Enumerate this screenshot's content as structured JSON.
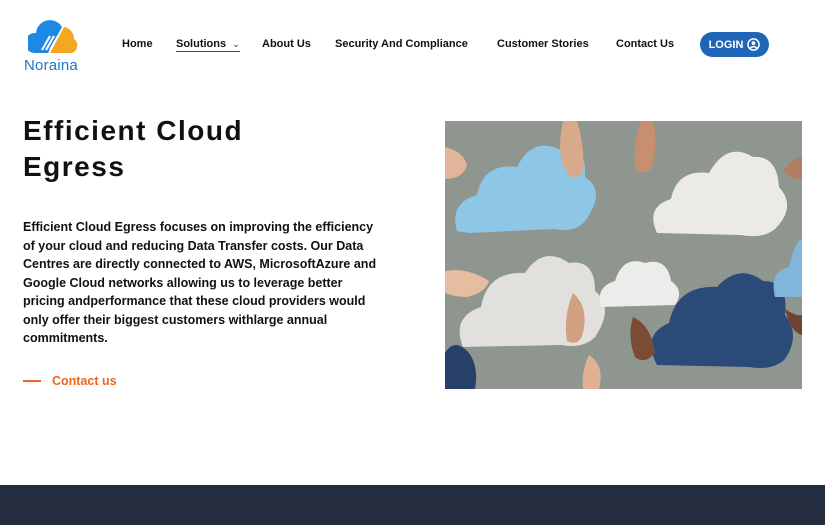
{
  "brand": {
    "name": "Noraina",
    "logo_colors": [
      "#1e88e5",
      "#f5a623"
    ]
  },
  "nav": {
    "items": [
      {
        "label": "Home"
      },
      {
        "label": "Solutions",
        "dropdown": true,
        "active": true
      },
      {
        "label": "About Us"
      },
      {
        "label": "Security And Compliance"
      },
      {
        "label": "Customer Stories"
      },
      {
        "label": "Contact Us"
      }
    ],
    "login_label": "LOGIN",
    "login_icon": "user-circle-icon"
  },
  "hero": {
    "title_line1": "Efficient Cloud",
    "title_line2": "Egress",
    "description": "Efficient Cloud Egress focuses on improving the efficiency of your cloud and reducing Data Transfer costs. Our Data Centres are directly connected to AWS, MicrosoftAzure and Google Cloud networks allowing us to leverage better pricing andperformance that these cloud providers would only offer their biggest customers withlarge annual commitments.",
    "cta_label": "Contact us"
  },
  "colors": {
    "accent": "#f0641e",
    "login_bg": "#1f64b7",
    "footer_bg": "#242c3f"
  }
}
